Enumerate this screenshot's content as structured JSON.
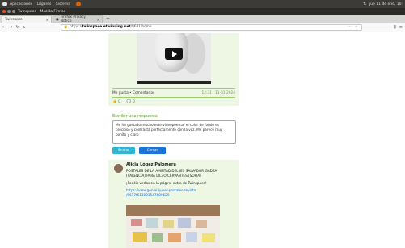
{
  "system": {
    "menu": [
      "Aplicaciones",
      "Lugares",
      "Sistema"
    ],
    "clock": "jue 11 de ene, 10:"
  },
  "window": {
    "title": "Twinspace - Mozilla Firefox"
  },
  "tabs": [
    {
      "label": "Twinspace",
      "close": "×"
    },
    {
      "label": "Firefox Privacy Notice",
      "close": "×"
    }
  ],
  "nav": {
    "url_prefix": "https://",
    "url_host": "twinspace.etwinning.net",
    "url_path": "/9641/home",
    "url_icons": "··· ☆"
  },
  "post1": {
    "meta_left": "Me gusta • Comentarios",
    "meta_time": "12:31",
    "meta_date": "11-01-2024",
    "likes": "0",
    "comments": "0"
  },
  "reply": {
    "heading": "Escribir una respuesta",
    "text": "Me ha gustado mucho este videopoema, el color de fondo es precioso y contrasta perfectamente con la voz. Me parece muy bonito y claro",
    "send_label": "Enviar",
    "close_label": "Cerrar"
  },
  "post2": {
    "author": "Alicia López Palomera",
    "line1": "POSTALES DE LA AMISTAD DEL IES SALVADOR GADEA (VALENCIA) PARA LICEO CERVANTES (SOFIA)",
    "line2": "¡Podéis verlas en la página extra de Twinspace!",
    "link": "https://view.genial.ly/ver-postales-revista /6617f613001547689629"
  }
}
